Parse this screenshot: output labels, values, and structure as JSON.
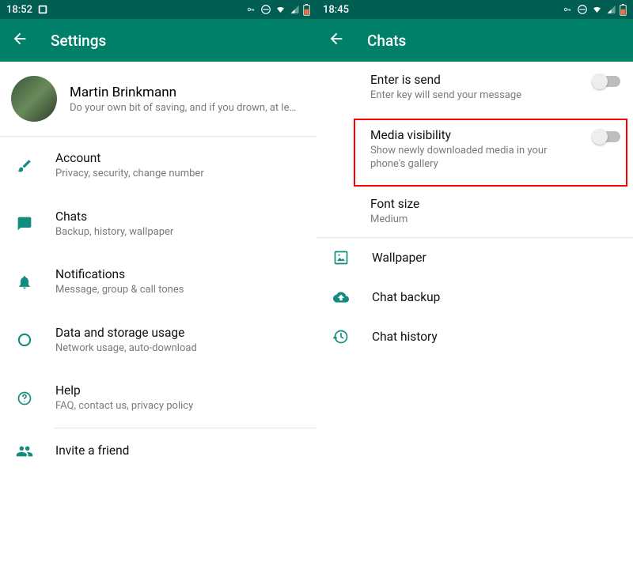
{
  "left": {
    "status": {
      "time": "18:52"
    },
    "header": {
      "title": "Settings"
    },
    "profile": {
      "name": "Martin Brinkmann",
      "status": "Do your own bit of saving, and if you drown, at le…"
    },
    "items": [
      {
        "title": "Account",
        "sub": "Privacy, security, change number"
      },
      {
        "title": "Chats",
        "sub": "Backup, history, wallpaper"
      },
      {
        "title": "Notifications",
        "sub": "Message, group & call tones"
      },
      {
        "title": "Data and storage usage",
        "sub": "Network usage, auto-download"
      },
      {
        "title": "Help",
        "sub": "FAQ, contact us, privacy policy"
      },
      {
        "title": "Invite a friend"
      }
    ]
  },
  "right": {
    "status": {
      "time": "18:45"
    },
    "header": {
      "title": "Chats"
    },
    "items": [
      {
        "title": "Enter is send",
        "sub": "Enter key will send your message",
        "toggle": false
      },
      {
        "title": "Media visibility",
        "sub": "Show newly downloaded media in your phone's gallery",
        "toggle": false,
        "highlighted": true
      },
      {
        "title": "Font size",
        "sub": "Medium"
      }
    ],
    "iconItems": [
      {
        "title": "Wallpaper"
      },
      {
        "title": "Chat backup"
      },
      {
        "title": "Chat history"
      }
    ]
  }
}
